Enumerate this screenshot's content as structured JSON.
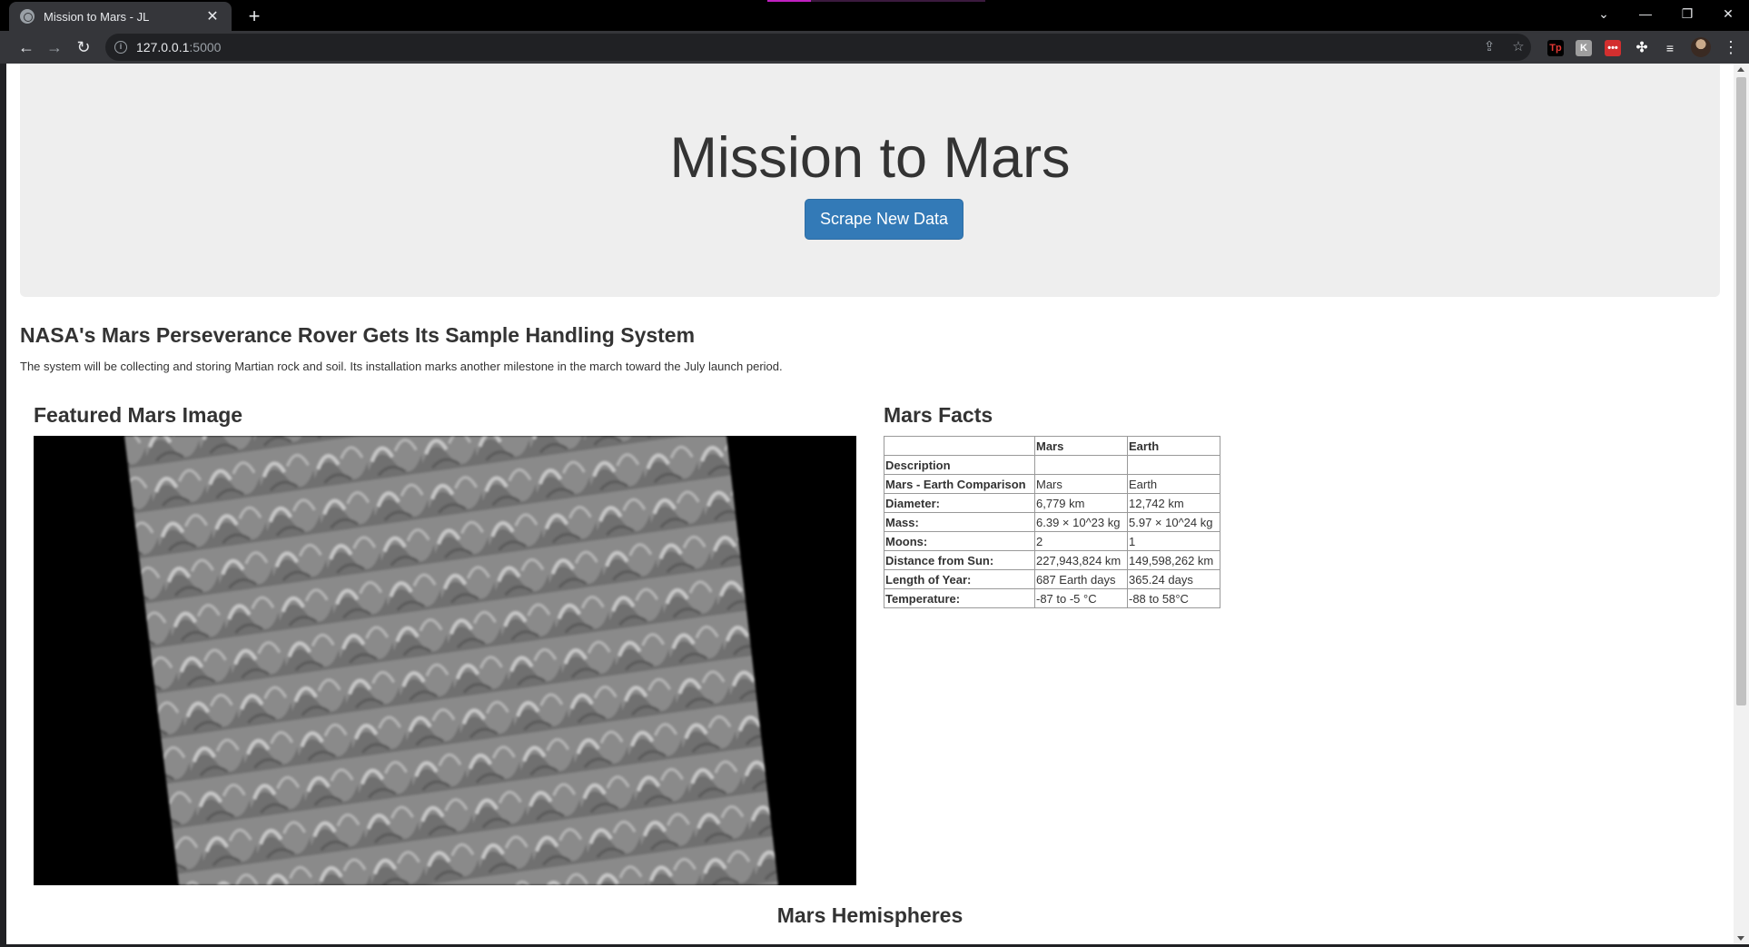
{
  "browser": {
    "tab_title": "Mission to Mars - JL",
    "url_host": "127.0.0.1",
    "url_port": ":5000"
  },
  "header": {
    "title": "Mission to Mars",
    "scrape_button": "Scrape New Data"
  },
  "news": {
    "title": "NASA's Mars Perseverance Rover Gets Its Sample Handling System",
    "paragraph": "The system will be collecting and storing Martian rock and soil. Its installation marks another milestone in the march toward the July launch period."
  },
  "featured": {
    "title": "Featured Mars Image"
  },
  "facts": {
    "title": "Mars Facts",
    "columns": [
      "",
      "Mars",
      "Earth"
    ],
    "rows": [
      {
        "label": "Description",
        "mars": "",
        "earth": ""
      },
      {
        "label": "Mars - Earth Comparison",
        "mars": "Mars",
        "earth": "Earth"
      },
      {
        "label": "Diameter:",
        "mars": "6,779 km",
        "earth": "12,742 km"
      },
      {
        "label": "Mass:",
        "mars": "6.39 × 10^23 kg",
        "earth": "5.97 × 10^24 kg"
      },
      {
        "label": "Moons:",
        "mars": "2",
        "earth": "1"
      },
      {
        "label": "Distance from Sun:",
        "mars": "227,943,824 km",
        "earth": "149,598,262 km"
      },
      {
        "label": "Length of Year:",
        "mars": "687 Earth days",
        "earth": "365.24 days"
      },
      {
        "label": "Temperature:",
        "mars": "-87 to -5 °C",
        "earth": "-88 to 58°C"
      }
    ]
  },
  "hemispheres": {
    "title": "Mars Hemispheres"
  },
  "colors": {
    "button_primary": "#337ab7",
    "jumbotron_bg": "#eeeeee",
    "text": "#333333"
  }
}
